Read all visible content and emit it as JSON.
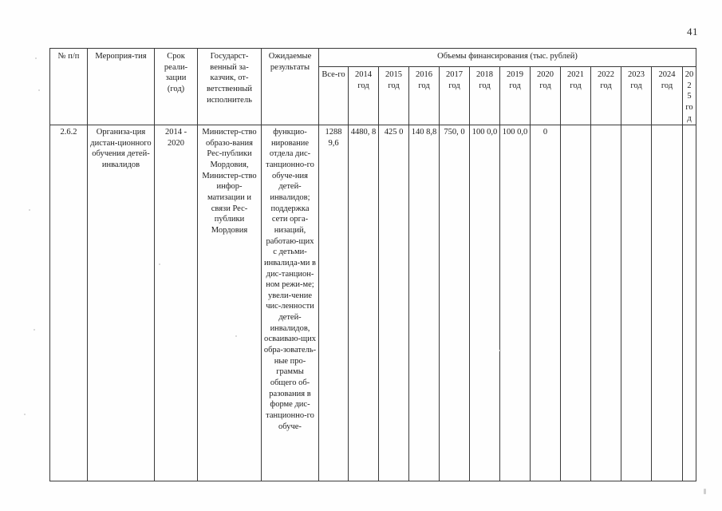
{
  "document": {
    "page_number": "41"
  },
  "table": {
    "headers": {
      "number": "№ п/п",
      "event": "Мероприя-тия",
      "term": "Срок реали-зации (год)",
      "customer": "Государст-венный за-казчик, от-ветственный исполнитель",
      "result": "Ожидаемые результаты",
      "finance_group": "Объемы финансирования (тыс. рублей)",
      "years": [
        "Все-го",
        "2014 год",
        "2015 год",
        "2016 год",
        "2017 год",
        "2018 год",
        "2019 год",
        "2020 год",
        "2021 год",
        "2022 год",
        "2023 год",
        "2024 год",
        "202 5 год"
      ]
    },
    "rows": [
      {
        "number": "2.6.2",
        "event": "Организа-ция дистан-ционного обучения детей-инвалидов",
        "term": "2014 - 2020",
        "customer": "Министер-ство образо-вания Рес-публики Мордовия, Министер-ство инфор-матизации и связи Рес-публики Мордовия",
        "result": "функцио-нирование отдела дис-танционно-го обуче-ния детей-инвалидов; поддержка сети орга-низаций, работаю-щих с детьми-инвалида-ми в дис-танцион-ном режи-ме; увели-чение чис-ленности детей-инвалидов, осваиваю-щих обра-зователь-ные про-граммы общего об-разования в форме дис-танционно-го обуче-",
        "values": [
          "1288 9,6",
          "4480, 8",
          "425 0",
          "140 8,8",
          "750, 0",
          "100 0,0",
          "100 0,0",
          "0",
          "",
          "",
          "",
          "",
          ""
        ]
      }
    ]
  }
}
